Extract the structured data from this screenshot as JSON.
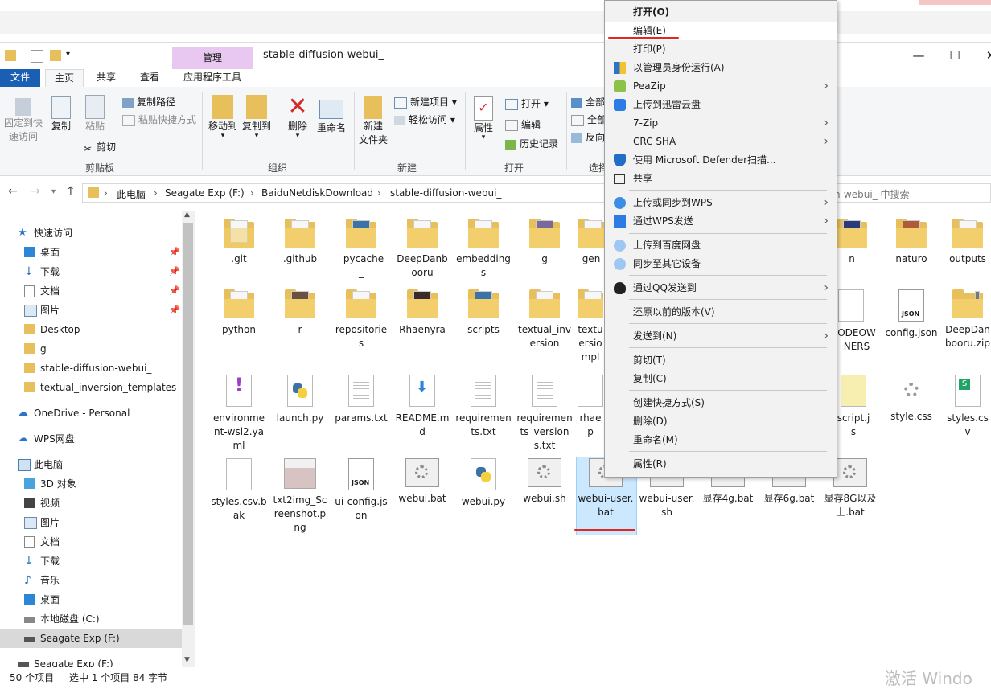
{
  "window": {
    "title": "stable-diffusion-webui_",
    "manage_tab": "管理",
    "min": "—",
    "max": "☐",
    "close": "✕"
  },
  "tabs": [
    {
      "label": "文件"
    },
    {
      "label": "主页"
    },
    {
      "label": "共享"
    },
    {
      "label": "查看"
    },
    {
      "label": "应用程序工具"
    }
  ],
  "ribbon": {
    "pin_quick": "固定到快速访问",
    "pin_quick_l1": "固定到快",
    "pin_quick_l2": "速访问",
    "copy": "复制",
    "paste": "粘贴",
    "copy_path": "复制路径",
    "paste_shortcut": "粘贴快捷方式",
    "cut": "剪切",
    "group_clipboard": "剪贴板",
    "move_to": "移动到",
    "copy_to": "复制到",
    "delete": "删除",
    "rename": "重命名",
    "group_organize": "组织",
    "new_folder_l1": "新建",
    "new_folder_l2": "文件夹",
    "new_item": "新建项目",
    "easy_access": "轻松访问",
    "group_new": "新建",
    "properties": "属性",
    "open": "打开",
    "edit": "编辑",
    "history": "历史记录",
    "group_open": "打开",
    "select_all_1": "全部",
    "select_all_2": "全部",
    "invert": "反向",
    "group_select": "选择"
  },
  "address": {
    "crumbs": [
      "此电脑",
      "Seagate Exp (F:)",
      "BaiduNetdiskDownload",
      "stable-diffusion-webui_"
    ],
    "search_hint": "n-webui_ 中搜索"
  },
  "nav": {
    "items": [
      {
        "label": "快速访问"
      },
      {
        "label": "桌面"
      },
      {
        "label": "下载"
      },
      {
        "label": "文档"
      },
      {
        "label": "图片"
      },
      {
        "label": "Desktop"
      },
      {
        "label": "g"
      },
      {
        "label": "stable-diffusion-webui_"
      },
      {
        "label": "textual_inversion_templates"
      },
      {
        "label": "OneDrive - Personal"
      },
      {
        "label": "WPS网盘"
      },
      {
        "label": "此电脑"
      },
      {
        "label": "3D 对象"
      },
      {
        "label": "视频"
      },
      {
        "label": "图片"
      },
      {
        "label": "文档"
      },
      {
        "label": "下载"
      },
      {
        "label": "音乐"
      },
      {
        "label": "桌面"
      },
      {
        "label": "本地磁盘 (C:)"
      },
      {
        "label": "Seagate Exp (F:)"
      },
      {
        "label": "Seagate Exp (F:)"
      }
    ]
  },
  "files": [
    {
      "name": ".git"
    },
    {
      "name": ".github"
    },
    {
      "name": "__pycache__"
    },
    {
      "name": "DeepDanbooru"
    },
    {
      "name": "embeddings"
    },
    {
      "name": "g"
    },
    {
      "name": "gen"
    },
    {
      "name": "n"
    },
    {
      "name": "naturo"
    },
    {
      "name": "outputs"
    },
    {
      "name": "python"
    },
    {
      "name": "r"
    },
    {
      "name": "repositories"
    },
    {
      "name": "Rhaenyra"
    },
    {
      "name": "scripts"
    },
    {
      "name": "textual_inversion"
    },
    {
      "name": "textu ersio mpl"
    },
    {
      "name": "ODEOW NERS"
    },
    {
      "name": "config.json"
    },
    {
      "name": "DeepDanbooru.zip"
    },
    {
      "name": "environment-wsl2.yaml"
    },
    {
      "name": "launch.py"
    },
    {
      "name": "params.txt"
    },
    {
      "name": "README.md"
    },
    {
      "name": "requirements.txt"
    },
    {
      "name": "requirements_versions.txt"
    },
    {
      "name": "rhae p"
    },
    {
      "name": "script.js"
    },
    {
      "name": "style.css"
    },
    {
      "name": "styles.csv"
    },
    {
      "name": "styles.csv.bak"
    },
    {
      "name": "txt2img_Screenshot.png"
    },
    {
      "name": "ui-config.json"
    },
    {
      "name": "webui.bat"
    },
    {
      "name": "webui.py"
    },
    {
      "name": "webui.sh"
    },
    {
      "name": "webui-user.bat"
    },
    {
      "name": "webui-user.sh"
    },
    {
      "name": "显存4g.bat"
    },
    {
      "name": "显存6g.bat"
    },
    {
      "name": "显存8G以及上.bat"
    }
  ],
  "menu": [
    {
      "label": "打开(O)"
    },
    {
      "label": "编辑(E)"
    },
    {
      "label": "打印(P)"
    },
    {
      "label": "以管理员身份运行(A)"
    },
    {
      "label": "PeaZip"
    },
    {
      "label": "上传到迅雷云盘"
    },
    {
      "label": "7-Zip"
    },
    {
      "label": "CRC SHA"
    },
    {
      "label": "使用 Microsoft Defender扫描..."
    },
    {
      "label": "共享"
    },
    {
      "label": "上传或同步到WPS"
    },
    {
      "label": "通过WPS发送"
    },
    {
      "label": "上传到百度网盘"
    },
    {
      "label": "同步至其它设备"
    },
    {
      "label": "通过QQ发送到"
    },
    {
      "label": "还原以前的版本(V)"
    },
    {
      "label": "发送到(N)"
    },
    {
      "label": "剪切(T)"
    },
    {
      "label": "复制(C)"
    },
    {
      "label": "创建快捷方式(S)"
    },
    {
      "label": "删除(D)"
    },
    {
      "label": "重命名(M)"
    },
    {
      "label": "属性(R)"
    }
  ],
  "status": {
    "count": "50 个项目",
    "selected": "选中 1 个项目  84 字节"
  },
  "watermark": "激活 Windo"
}
